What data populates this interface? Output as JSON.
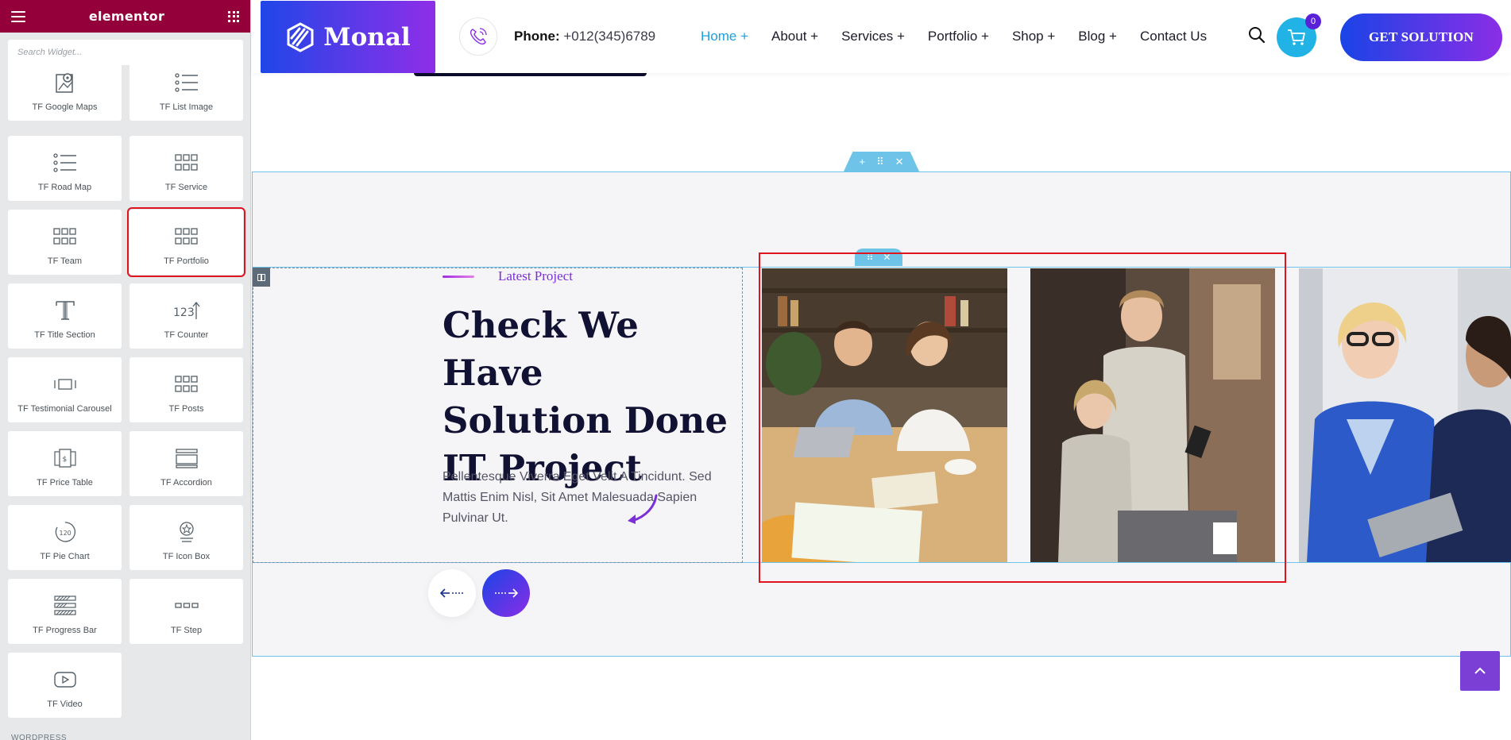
{
  "panel": {
    "brand": "elementor",
    "search_placeholder": "Search Widget...",
    "footer_label": "WORDPRESS",
    "widgets": [
      {
        "label": "TF Google Maps",
        "icon": "map-pin-icon"
      },
      {
        "label": "TF List Image",
        "icon": "list-icon"
      },
      {
        "label": "TF Road Map",
        "icon": "list-icon"
      },
      {
        "label": "TF Service",
        "icon": "grid-icon"
      },
      {
        "label": "TF Team",
        "icon": "grid-icon"
      },
      {
        "label": "TF Portfolio",
        "icon": "grid-icon",
        "selected": true
      },
      {
        "label": "TF Title Section",
        "icon": "title-t-icon"
      },
      {
        "label": "TF Counter",
        "icon": "counter-icon"
      },
      {
        "label": "TF Testimonial Carousel",
        "icon": "carousel-icon"
      },
      {
        "label": "TF Posts",
        "icon": "grid-icon"
      },
      {
        "label": "TF Price Table",
        "icon": "price-table-icon"
      },
      {
        "label": "TF Accordion",
        "icon": "accordion-icon"
      },
      {
        "label": "TF Pie Chart",
        "icon": "pie-chart-icon"
      },
      {
        "label": "TF Icon Box",
        "icon": "icon-box-icon"
      },
      {
        "label": "TF Progress Bar",
        "icon": "progress-bar-icon"
      },
      {
        "label": "TF Step",
        "icon": "step-icon"
      },
      {
        "label": "TF Video",
        "icon": "video-icon"
      }
    ]
  },
  "header": {
    "logo_text": "Monal",
    "phone_label": "Phone:",
    "phone_number": "+012(345)6789",
    "nav": [
      {
        "label": "Home +",
        "active": true
      },
      {
        "label": "About +"
      },
      {
        "label": "Services +"
      },
      {
        "label": "Portfolio +"
      },
      {
        "label": "Shop +"
      },
      {
        "label": "Blog +"
      },
      {
        "label": "Contact Us"
      }
    ],
    "cart_count": "0",
    "cta_label": "GET SOLUTION"
  },
  "section": {
    "eyebrow": "Latest Project",
    "heading_lines": [
      "Check We Have",
      "Solution Done",
      "IT Project"
    ],
    "description": "Pellentesque Viverra Eget Velit A Tincidunt. Sed Mattis Enim Nisl, Sit Amet Malesuada Sapien Pulvinar Ut."
  },
  "colors": {
    "panel_header": "#93003a",
    "accent_blue": "#1ba1e0",
    "gradient_start": "#1a44e6",
    "gradient_end": "#8b2de6",
    "editor_outline": "#6ec3e8",
    "selection_red": "#e0141e"
  }
}
